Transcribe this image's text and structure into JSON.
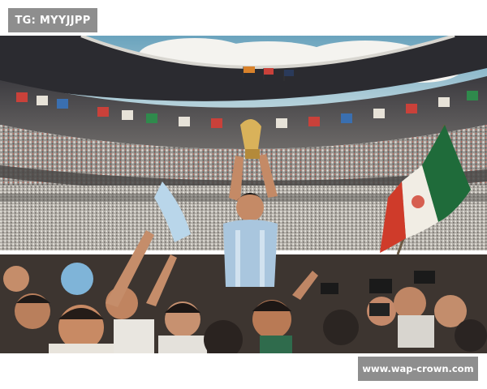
{
  "watermark_top": "TG: MYYJJPP",
  "watermark_bottom": "www.wap-crown.com",
  "photo": {
    "subject": "player-lifted-holding-trophy",
    "colors": {
      "sky": "#7fb2c9",
      "cloud": "#f2f2ee",
      "stadium_shadow": "#2a2a30",
      "crowd_light": "#c9c6c0",
      "jersey": "#a9c6de",
      "flag_green": "#1f6b3a",
      "flag_red": "#cf3b2a",
      "flag_white": "#f1ede4"
    }
  }
}
